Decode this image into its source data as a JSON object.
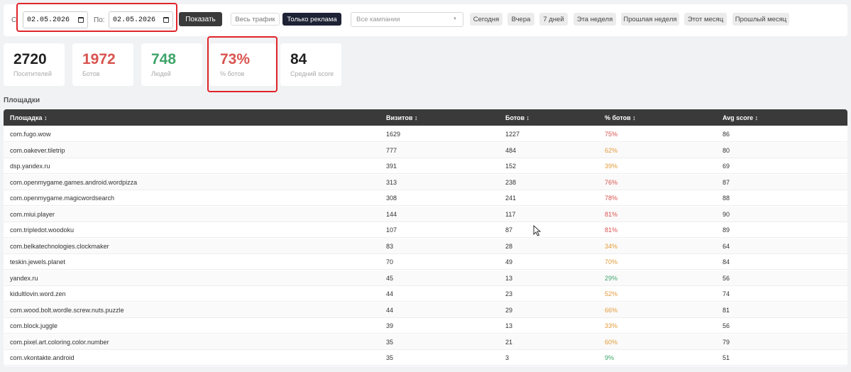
{
  "toolbar": {
    "from_label": "С",
    "from_value": "02.05.2026",
    "to_label": "По:",
    "to_value": "02.05.2026",
    "show_button": "Показать",
    "all_traffic": "Весь трафик",
    "ads_only": "Только реклама",
    "campaign_select": "Все кампании",
    "quick": [
      "Сегодня",
      "Вчера",
      "7 дней",
      "Эта неделя",
      "Прошлая неделя",
      "Этот месяц",
      "Прошлый месяц"
    ]
  },
  "stats": [
    {
      "value": "2720",
      "label": "Посетителей",
      "color": "#222222"
    },
    {
      "value": "1972",
      "label": "Ботов",
      "color": "#d9534f"
    },
    {
      "value": "748",
      "label": "Людей",
      "color": "#3fa46a"
    },
    {
      "value": "73%",
      "label": "% ботов",
      "color": "#d9534f"
    },
    {
      "value": "84",
      "label": "Средний score",
      "color": "#222222"
    }
  ],
  "section_title": "Площадки",
  "table": {
    "headers": [
      "Площадка ↕",
      "Визитов ↕",
      "Ботов ↕",
      "% ботов ↕",
      "Avg score ↕"
    ],
    "rows": [
      {
        "site": "com.fugo.wow",
        "visits": "1629",
        "bots": "1227",
        "pct": "75%",
        "color": "#d9534f",
        "score": "86"
      },
      {
        "site": "com.oakever.tiletrip",
        "visits": "777",
        "bots": "484",
        "pct": "62%",
        "color": "#e39a3a",
        "score": "80"
      },
      {
        "site": "dsp.yandex.ru",
        "visits": "391",
        "bots": "152",
        "pct": "39%",
        "color": "#e39a3a",
        "score": "69"
      },
      {
        "site": "com.openmygame.games.android.wordpizza",
        "visits": "313",
        "bots": "238",
        "pct": "76%",
        "color": "#d9534f",
        "score": "87"
      },
      {
        "site": "com.openmygame.magicwordsearch",
        "visits": "308",
        "bots": "241",
        "pct": "78%",
        "color": "#d9534f",
        "score": "88"
      },
      {
        "site": "com.miui.player",
        "visits": "144",
        "bots": "117",
        "pct": "81%",
        "color": "#d9534f",
        "score": "90"
      },
      {
        "site": "com.tripledot.woodoku",
        "visits": "107",
        "bots": "87",
        "pct": "81%",
        "color": "#d9534f",
        "score": "89"
      },
      {
        "site": "com.belkatechnologies.clockmaker",
        "visits": "83",
        "bots": "28",
        "pct": "34%",
        "color": "#e39a3a",
        "score": "64"
      },
      {
        "site": "teskin.jewels.planet",
        "visits": "70",
        "bots": "49",
        "pct": "70%",
        "color": "#e39a3a",
        "score": "84"
      },
      {
        "site": "yandex.ru",
        "visits": "45",
        "bots": "13",
        "pct": "29%",
        "color": "#3fa46a",
        "score": "56"
      },
      {
        "site": "kidultlovin.word.zen",
        "visits": "44",
        "bots": "23",
        "pct": "52%",
        "color": "#e39a3a",
        "score": "74"
      },
      {
        "site": "com.wood.bolt.wordle.screw.nuts.puzzle",
        "visits": "44",
        "bots": "29",
        "pct": "66%",
        "color": "#e39a3a",
        "score": "81"
      },
      {
        "site": "com.block.juggle",
        "visits": "39",
        "bots": "13",
        "pct": "33%",
        "color": "#e39a3a",
        "score": "56"
      },
      {
        "site": "com.pixel.art.coloring.color.number",
        "visits": "35",
        "bots": "21",
        "pct": "60%",
        "color": "#e39a3a",
        "score": "79"
      },
      {
        "site": "com.vkontakte.android",
        "visits": "35",
        "bots": "3",
        "pct": "9%",
        "color": "#3fa46a",
        "score": "51"
      }
    ]
  }
}
